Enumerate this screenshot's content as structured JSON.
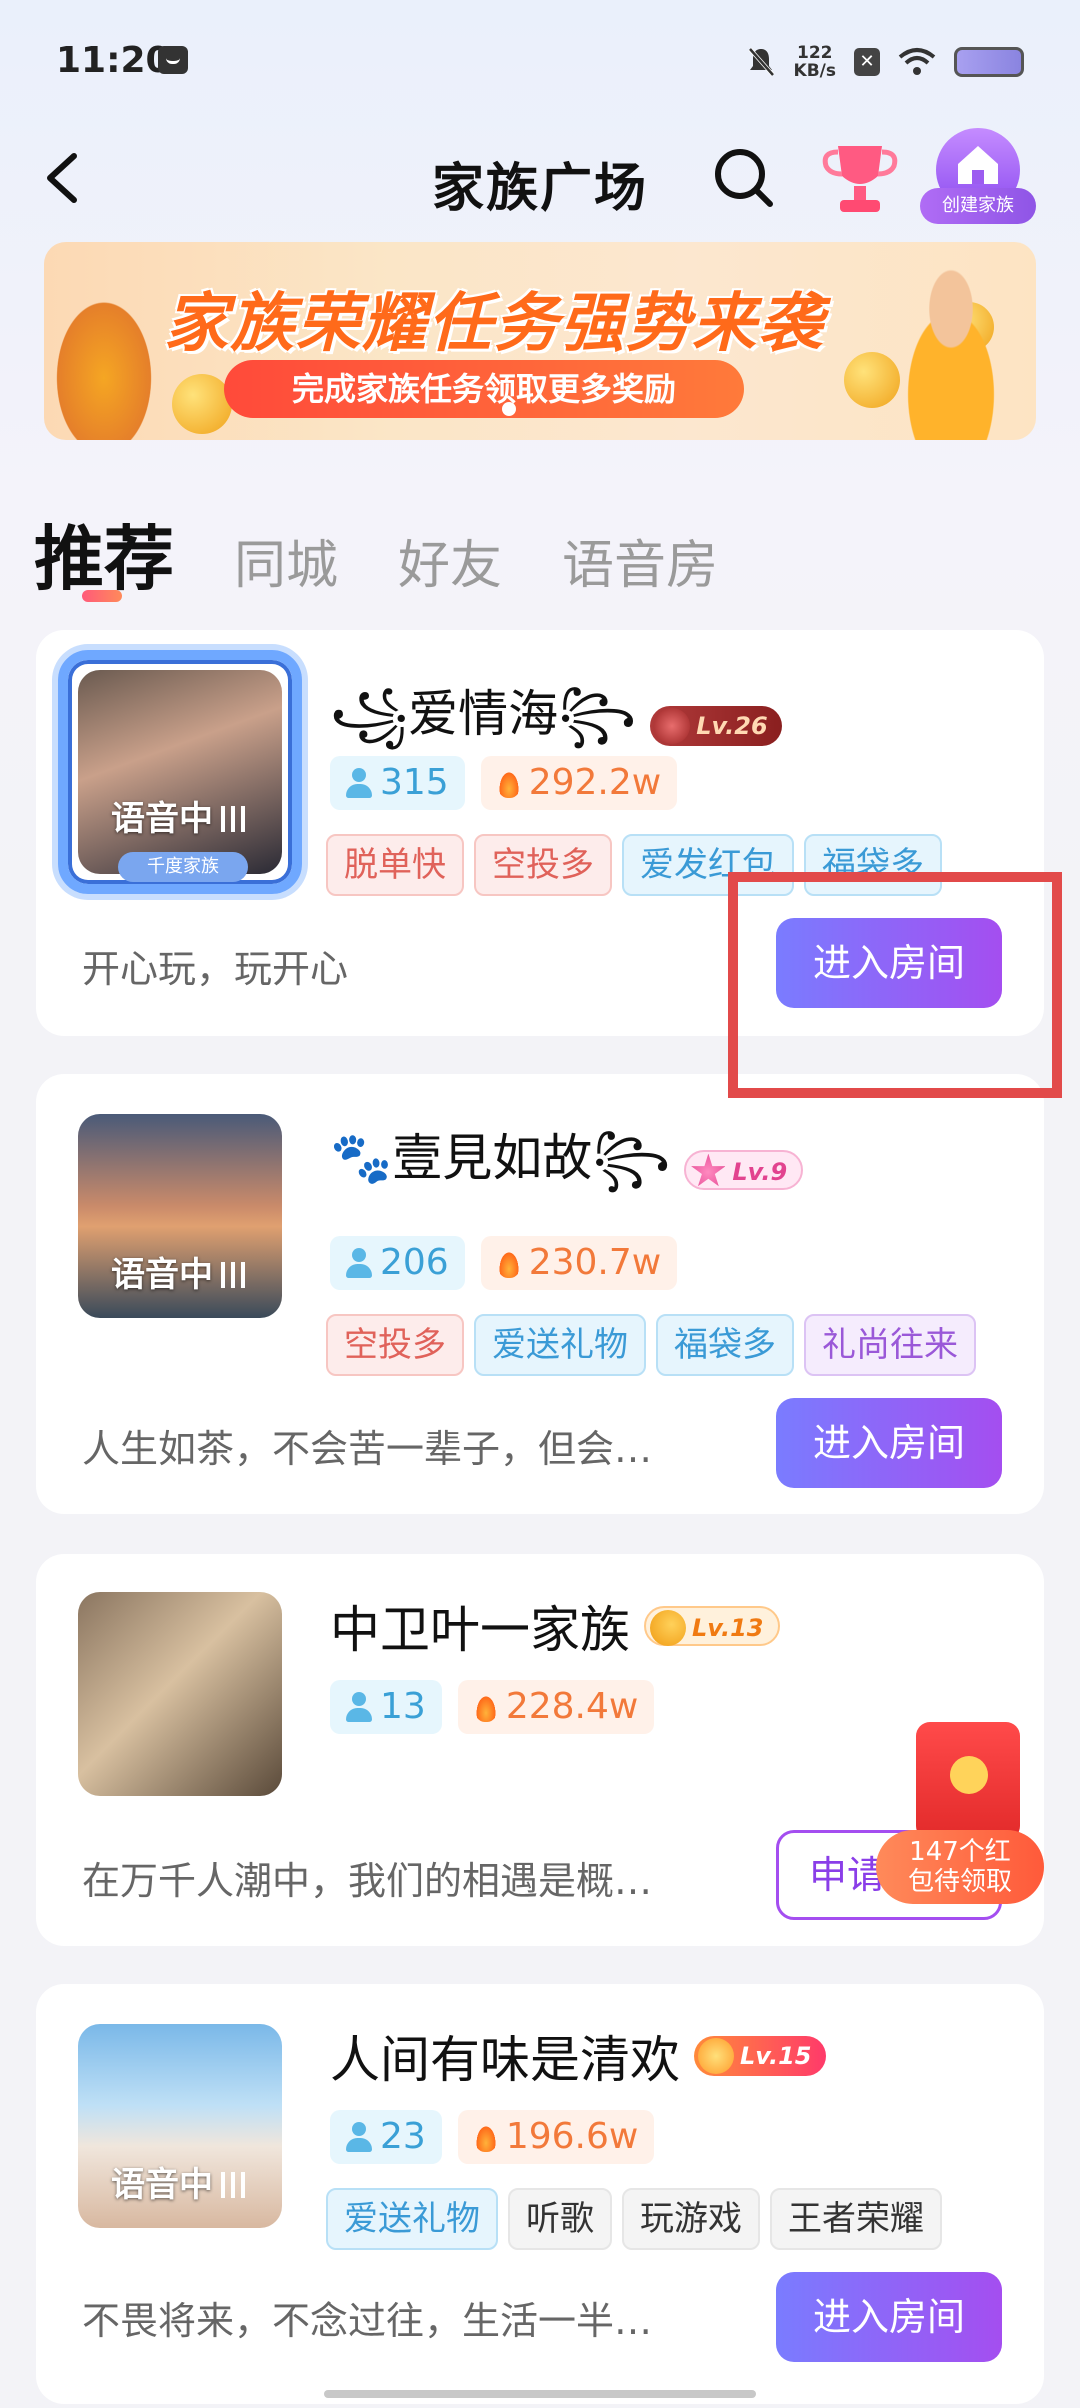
{
  "status_bar": {
    "time": "11:20",
    "speed_value": "122",
    "speed_unit": "KB/s"
  },
  "header": {
    "title": "家族广场",
    "create_family_label": "创建家族"
  },
  "banner": {
    "title": "家族荣耀任务强势来袭",
    "subtitle": "完成家族任务领取更多奖励"
  },
  "tabs": [
    "推荐",
    "同城",
    "好友",
    "语音房"
  ],
  "cards": [
    {
      "name": "꧁爱情海꧂",
      "level": "Lv.26",
      "members": "315",
      "heat": "292.2w",
      "live_label": "语音中",
      "frame_tag": "千度家族",
      "tags": [
        "脱单快",
        "空投多",
        "爱发红包",
        "福袋多"
      ],
      "description": "开心玩，玩开心",
      "action": "进入房间"
    },
    {
      "name": "🐾壹見如故꧂",
      "level": "Lv.9",
      "members": "206",
      "heat": "230.7w",
      "live_label": "语音中",
      "tags": [
        "空投多",
        "爱送礼物",
        "福袋多",
        "礼尚往来"
      ],
      "description": "人生如茶，不会苦一辈子，但会…",
      "action": "进入房间"
    },
    {
      "name": "中卫叶一家族",
      "level": "Lv.13",
      "members": "13",
      "heat": "228.4w",
      "description": "在万千人潮中，我们的相遇是概…",
      "action": "申请"
    },
    {
      "name": "人间有味是清欢",
      "level": "Lv.15",
      "members": "23",
      "heat": "196.6w",
      "live_label": "语音中",
      "tags": [
        "爱送礼物",
        "听歌",
        "玩游戏",
        "王者荣耀"
      ],
      "description": "不畏将来，不念过往，生活一半…",
      "action": "进入房间"
    }
  ],
  "red_packet": {
    "line1": "147个红",
    "line2": "包待领取"
  }
}
